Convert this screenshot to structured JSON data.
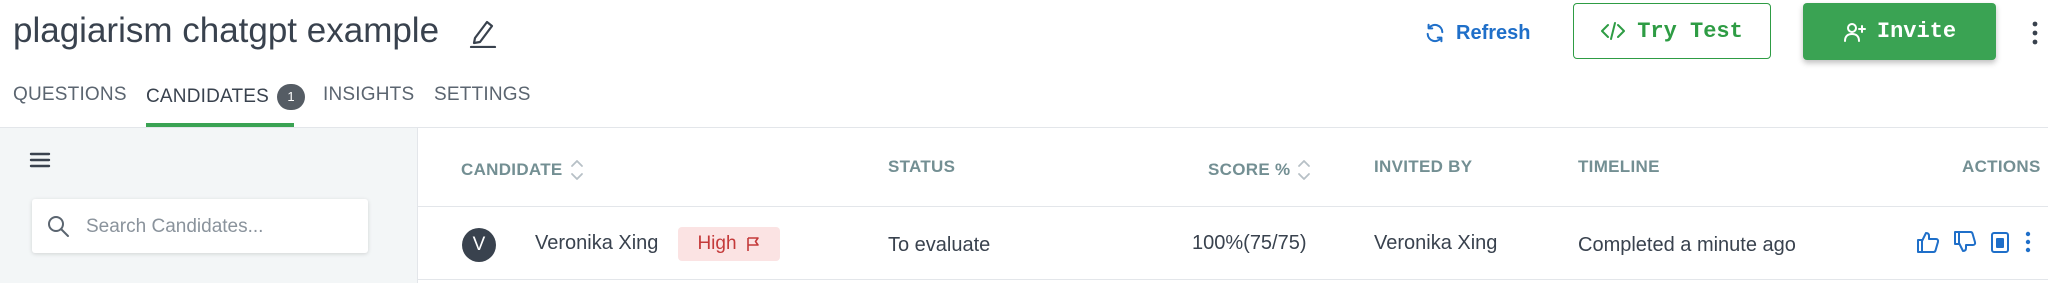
{
  "header": {
    "title": "plagiarism chatgpt example",
    "refresh_label": "Refresh",
    "try_test_label": "Try Test",
    "invite_label": "Invite"
  },
  "tabs": {
    "questions": "QUESTIONS",
    "candidates": "CANDIDATES",
    "candidates_count": "1",
    "insights": "INSIGHTS",
    "settings": "SETTINGS",
    "active": "candidates"
  },
  "sidebar": {
    "search_placeholder": "Search Candidates...",
    "search_value": ""
  },
  "table": {
    "columns": {
      "candidate": "CANDIDATE",
      "status": "STATUS",
      "score": "SCORE %",
      "invited_by": "INVITED BY",
      "timeline": "TIMELINE",
      "actions": "ACTIONS"
    },
    "rows": [
      {
        "avatar_initial": "V",
        "name": "Veronika Xing",
        "risk": "High",
        "status": "To evaluate",
        "score": "100%(75/75)",
        "invited_by": "Veronika Xing",
        "timeline": "Completed a minute ago"
      }
    ]
  },
  "icons": {
    "edit": "pencil-icon",
    "refresh": "refresh-icon",
    "try_test": "code-icon",
    "invite": "add-user-icon",
    "more": "vertical-dots-icon",
    "menu": "hamburger-icon",
    "search": "search-icon",
    "sort": "sort-icon",
    "risk": "flag-icon",
    "approve": "thumbs-up-icon",
    "reject": "thumbs-down-icon",
    "report": "report-icon"
  },
  "colors": {
    "accent_green": "#3aa353",
    "link_blue": "#1f6fc9",
    "risk_red": "#c43a3a",
    "risk_bg": "#fbe3e3",
    "action_blue": "#1f6fc9"
  }
}
